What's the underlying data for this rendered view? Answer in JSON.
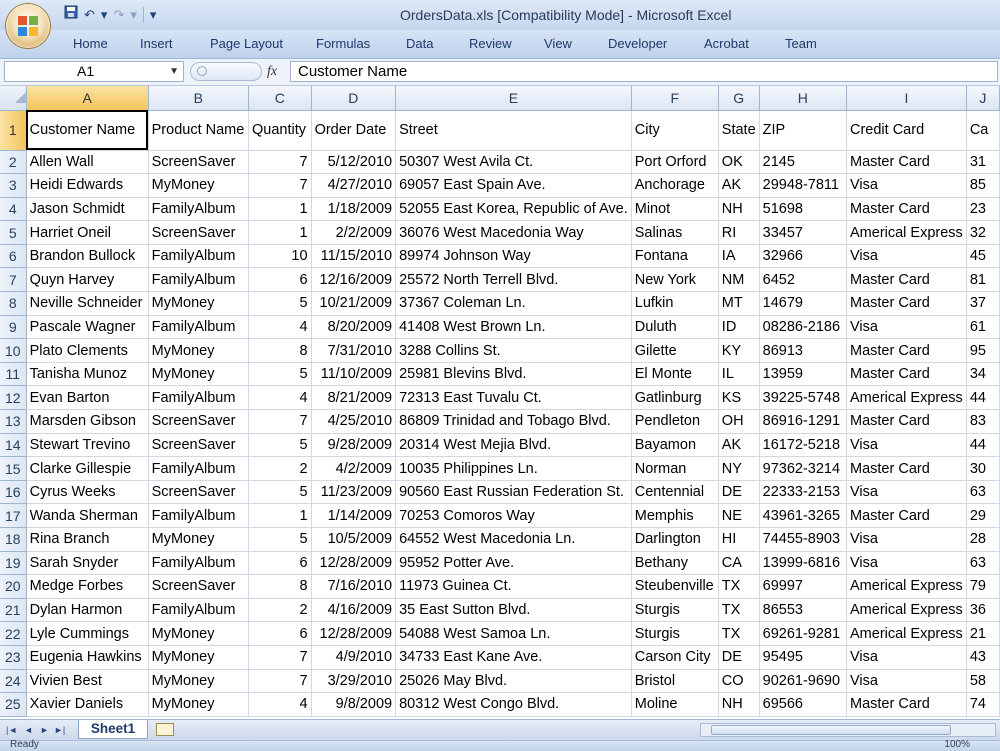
{
  "window": {
    "title": "OrdersData.xls  [Compatibility Mode]  -  Microsoft Excel"
  },
  "qat": {
    "separator": "|",
    "undo_icon": "↶",
    "redo_icon": "↷",
    "dropdown_icon": "▾",
    "save_icon": "💾"
  },
  "ribbon": {
    "tabs": [
      "Home",
      "Insert",
      "Page Layout",
      "Formulas",
      "Data",
      "Review",
      "View",
      "Developer",
      "Acrobat",
      "Team"
    ]
  },
  "formula_bar": {
    "name_box": "A1",
    "fx": "fx",
    "content": "Customer Name"
  },
  "grid": {
    "columns": [
      "A",
      "B",
      "C",
      "D",
      "E",
      "F",
      "G",
      "H",
      "I",
      "J"
    ],
    "selected_column": "A",
    "headers": [
      "Customer Name",
      "Product Name",
      "Quantity",
      "Order Date",
      "Street",
      "City",
      "State",
      "ZIP",
      "Credit Card",
      "Ca"
    ],
    "rows": [
      [
        "Allen Wall",
        "ScreenSaver",
        "7",
        "5/12/2010",
        "50307 West Avila Ct.",
        "Port Orford",
        "OK",
        "2145",
        "Master Card",
        "31"
      ],
      [
        "Heidi Edwards",
        "MyMoney",
        "7",
        "4/27/2010",
        "69057 East Spain Ave.",
        "Anchorage",
        "AK",
        "29948-7811",
        "Visa",
        "85"
      ],
      [
        "Jason Schmidt",
        "FamilyAlbum",
        "1",
        "1/18/2009",
        "52055 East Korea, Republic of Ave.",
        "Minot",
        "NH",
        "51698",
        "Master Card",
        "23"
      ],
      [
        "Harriet Oneil",
        "ScreenSaver",
        "1",
        "2/2/2009",
        "36076 West Macedonia Way",
        "Salinas",
        "RI",
        "33457",
        "Americal Express",
        "32"
      ],
      [
        "Brandon Bullock",
        "FamilyAlbum",
        "10",
        "11/15/2010",
        "89974 Johnson Way",
        "Fontana",
        "IA",
        "32966",
        "Visa",
        "45"
      ],
      [
        "Quyn Harvey",
        "FamilyAlbum",
        "6",
        "12/16/2009",
        "25572 North Terrell Blvd.",
        "New York",
        "NM",
        "6452",
        "Master Card",
        "81"
      ],
      [
        "Neville Schneider",
        "MyMoney",
        "5",
        "10/21/2009",
        "37367 Coleman Ln.",
        "Lufkin",
        "MT",
        "14679",
        "Master Card",
        "37"
      ],
      [
        "Pascale Wagner",
        "FamilyAlbum",
        "4",
        "8/20/2009",
        "41408 West Brown Ln.",
        "Duluth",
        "ID",
        "08286-2186",
        "Visa",
        "61"
      ],
      [
        "Plato Clements",
        "MyMoney",
        "8",
        "7/31/2010",
        "3288 Collins St.",
        "Gilette",
        "KY",
        "86913",
        "Master Card",
        "95"
      ],
      [
        "Tanisha Munoz",
        "MyMoney",
        "5",
        "11/10/2009",
        "25981 Blevins Blvd.",
        "El Monte",
        "IL",
        "13959",
        "Master Card",
        "34"
      ],
      [
        "Evan Barton",
        "FamilyAlbum",
        "4",
        "8/21/2009",
        "72313 East Tuvalu Ct.",
        "Gatlinburg",
        "KS",
        "39225-5748",
        "Americal Express",
        "44"
      ],
      [
        "Marsden Gibson",
        "ScreenSaver",
        "7",
        "4/25/2010",
        "86809 Trinidad and Tobago Blvd.",
        "Pendleton",
        "OH",
        "86916-1291",
        "Master Card",
        "83"
      ],
      [
        "Stewart Trevino",
        "ScreenSaver",
        "5",
        "9/28/2009",
        "20314 West Mejia Blvd.",
        "Bayamon",
        "AK",
        "16172-5218",
        "Visa",
        "44"
      ],
      [
        "Clarke Gillespie",
        "FamilyAlbum",
        "2",
        "4/2/2009",
        "10035 Philippines Ln.",
        "Norman",
        "NY",
        "97362-3214",
        "Master Card",
        "30"
      ],
      [
        "Cyrus Weeks",
        "ScreenSaver",
        "5",
        "11/23/2009",
        "90560 East Russian Federation St.",
        "Centennial",
        "DE",
        "22333-2153",
        "Visa",
        "63"
      ],
      [
        "Wanda Sherman",
        "FamilyAlbum",
        "1",
        "1/14/2009",
        "70253 Comoros Way",
        "Memphis",
        "NE",
        "43961-3265",
        "Master Card",
        "29"
      ],
      [
        "Rina Branch",
        "MyMoney",
        "5",
        "10/5/2009",
        "64552 West Macedonia Ln.",
        "Darlington",
        "HI",
        "74455-8903",
        "Visa",
        "28"
      ],
      [
        "Sarah Snyder",
        "FamilyAlbum",
        "6",
        "12/28/2009",
        "95952 Potter Ave.",
        "Bethany",
        "CA",
        "13999-6816",
        "Visa",
        "63"
      ],
      [
        "Medge Forbes",
        "ScreenSaver",
        "8",
        "7/16/2010",
        "11973 Guinea Ct.",
        "Steubenville",
        "TX",
        "69997",
        "Americal Express",
        "79"
      ],
      [
        "Dylan Harmon",
        "FamilyAlbum",
        "2",
        "4/16/2009",
        "35 East Sutton Blvd.",
        "Sturgis",
        "TX",
        "86553",
        "Americal Express",
        "36"
      ],
      [
        "Lyle Cummings",
        "MyMoney",
        "6",
        "12/28/2009",
        "54088 West Samoa Ln.",
        "Sturgis",
        "TX",
        "69261-9281",
        "Americal Express",
        "21"
      ],
      [
        "Eugenia Hawkins",
        "MyMoney",
        "7",
        "4/9/2010",
        "34733 East Kane Ave.",
        "Carson City",
        "DE",
        "95495",
        "Visa",
        "43"
      ],
      [
        "Vivien Best",
        "MyMoney",
        "7",
        "3/29/2010",
        "25026 May Blvd.",
        "Bristol",
        "CO",
        "90261-9690",
        "Visa",
        "58"
      ],
      [
        "Xavier Daniels",
        "MyMoney",
        "4",
        "9/8/2009",
        "80312 West Congo Blvd.",
        "Moline",
        "NH",
        "69566",
        "Master Card",
        "74"
      ]
    ]
  },
  "sheets": {
    "active": "Sheet1",
    "nav": [
      "|◄",
      "◄",
      "►",
      "►|"
    ]
  },
  "status": {
    "left": "Ready",
    "zoom": "100%"
  }
}
